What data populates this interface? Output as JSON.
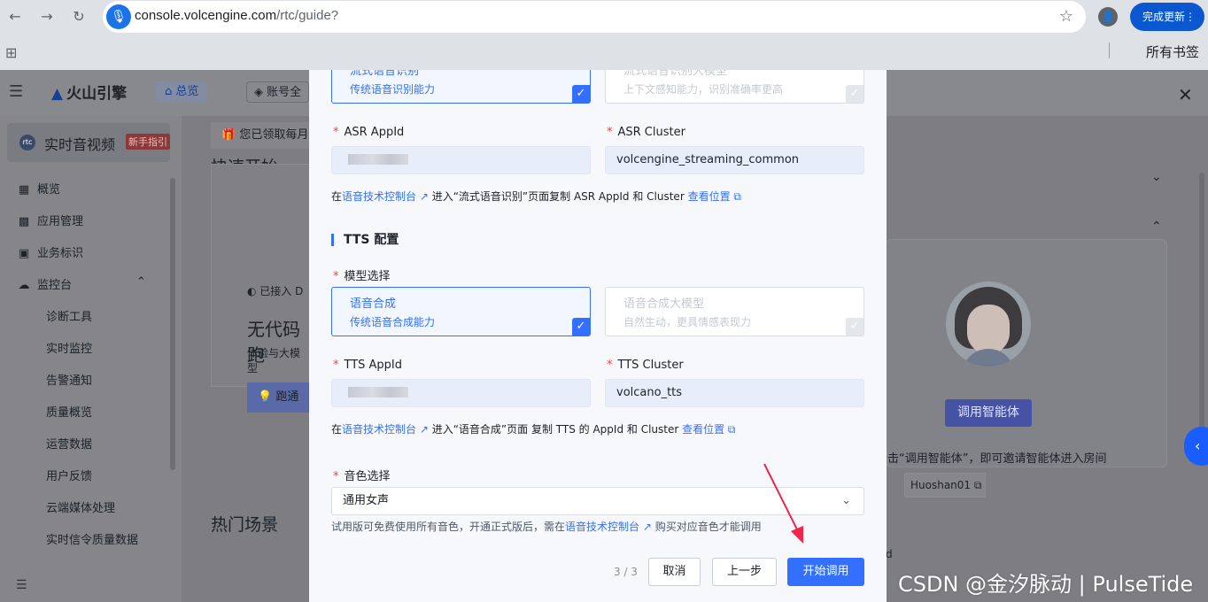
{
  "browser": {
    "url_host": "console.volcengine.com",
    "url_path": "/rtc/guide?",
    "update_label": "完成更新",
    "bookmarks_label": "所有书签"
  },
  "topbar": {
    "logo": "火山引擎",
    "home": "总览",
    "account": "账号全"
  },
  "sidebar": {
    "product": "实时音视频",
    "product_icon": "rtc",
    "badge": "新手指引",
    "items": [
      {
        "label": "概览",
        "icon": "▦"
      },
      {
        "label": "应用管理",
        "icon": "▩"
      },
      {
        "label": "业务标识",
        "icon": "▣"
      },
      {
        "label": "监控台",
        "icon": "☁"
      }
    ],
    "sub_items": [
      "诊断工具",
      "实时监控",
      "告警通知",
      "质量概览",
      "运营数据",
      "用户反馈",
      "云端媒体处理",
      "实时信令质量数据"
    ]
  },
  "background": {
    "quick_start": "快速开始",
    "gift": "您已领取每月",
    "connected": "已接入 D",
    "nocode": "无代码跑",
    "experience": "体验与大模型",
    "run": "跑通",
    "hot": "热门场景",
    "invite_hint": "击“调用智能体”，即可邀请智能体进入房间",
    "invite_btn": "调用智能体",
    "d_label": "d",
    "room": "Huoshan01"
  },
  "modal": {
    "asr_options": [
      {
        "title": "流式语音识别",
        "desc": "传统语音识别能力",
        "selected": true
      },
      {
        "title": "流式语音识别大模型",
        "desc": "上下文感知能力，识别准确率更高",
        "selected": false
      }
    ],
    "asr_appid_label": "ASR AppId",
    "asr_cluster_label": "ASR Cluster",
    "asr_cluster_value": "volcengine_streaming_common",
    "asr_hint": {
      "pre": "在",
      "link1": "语音技术控制台 ↗",
      "mid": " 进入“流式语音识别”页面复制 ASR AppId 和 Cluster ",
      "link2": "查看位置 ⧉"
    },
    "tts_section": "TTS 配置",
    "model_label": "模型选择",
    "tts_options": [
      {
        "title": "语音合成",
        "desc": "传统语音合成能力",
        "selected": true
      },
      {
        "title": "语音合成大模型",
        "desc": "自然生动，更具情感表现力",
        "selected": false
      }
    ],
    "tts_appid_label": "TTS AppId",
    "tts_cluster_label": "TTS Cluster",
    "tts_cluster_value": "volcano_tts",
    "tts_hint": {
      "pre": "在",
      "link1": "语音技术控制台 ↗",
      "mid": " 进入“语音合成”页面 复制 TTS 的 AppId 和 Cluster ",
      "link2": "查看位置 ⧉"
    },
    "voice_label": "音色选择",
    "voice_value": "通用女声",
    "voice_hint": {
      "pre": "试用版可免费使用所有音色，开通正式版后，需在",
      "link": "语音技术控制台 ↗",
      "post": " 购买对应音色才能调用"
    },
    "pager": "3 / 3",
    "cancel": "取消",
    "prev": "上一步",
    "start": "开始调用"
  },
  "watermark": "CSDN @金汐脉动 | PulseTide",
  "colors": {
    "primary": "#3370ff",
    "required": "#f53f3f",
    "annotation_arrow": "#f0254a"
  }
}
